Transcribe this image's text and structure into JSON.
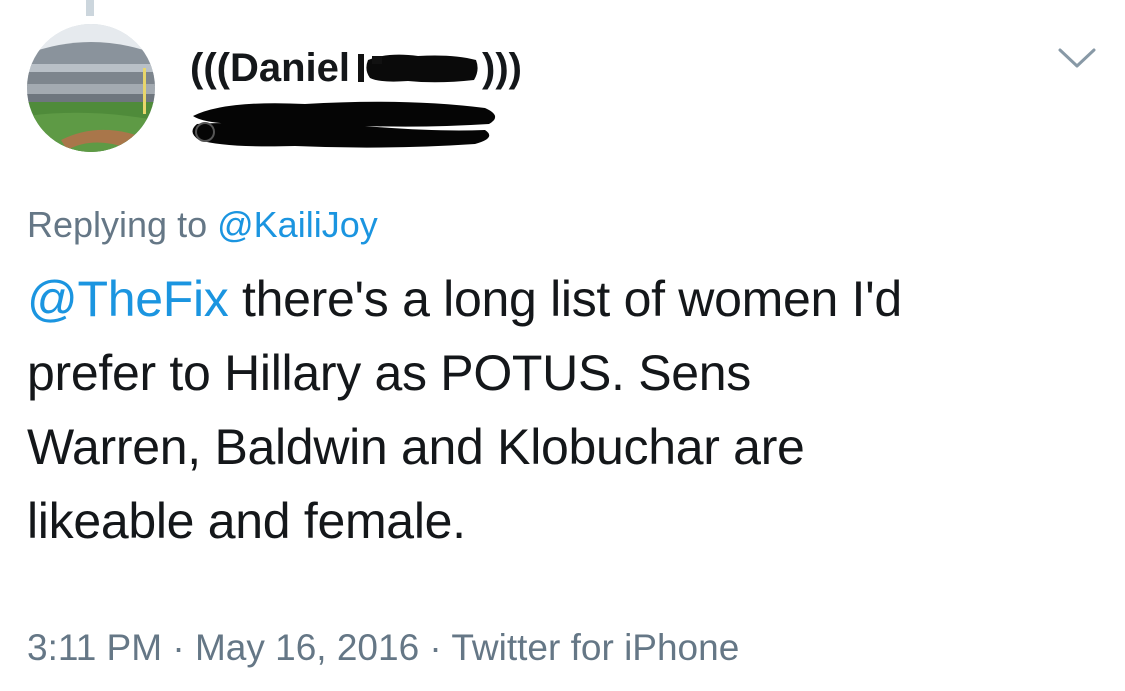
{
  "author": {
    "display_name_prefix": "(((Daniel",
    "display_name_suffix": ")))",
    "avatar_description": "baseball stadium photo",
    "name_redacted": true,
    "handle_redacted": true
  },
  "reply": {
    "prefix": "Replying to",
    "mention": "@KailiJoy"
  },
  "body": {
    "mention": "@TheFix",
    "line1_rest": " there's a long list of women I'd",
    "line2": "prefer to Hillary as POTUS. Sens",
    "line3": "Warren, Baldwin and Klobuchar are",
    "line4": "likeable and female."
  },
  "meta": {
    "time": "3:11 PM",
    "separator": " · ",
    "date": "May 16, 2016",
    "source": "Twitter for iPhone"
  },
  "icons": {
    "caret": "chevron-down-icon"
  },
  "colors": {
    "link": "#1b95e0",
    "secondary_text": "#657786",
    "primary_text": "#14171a"
  }
}
